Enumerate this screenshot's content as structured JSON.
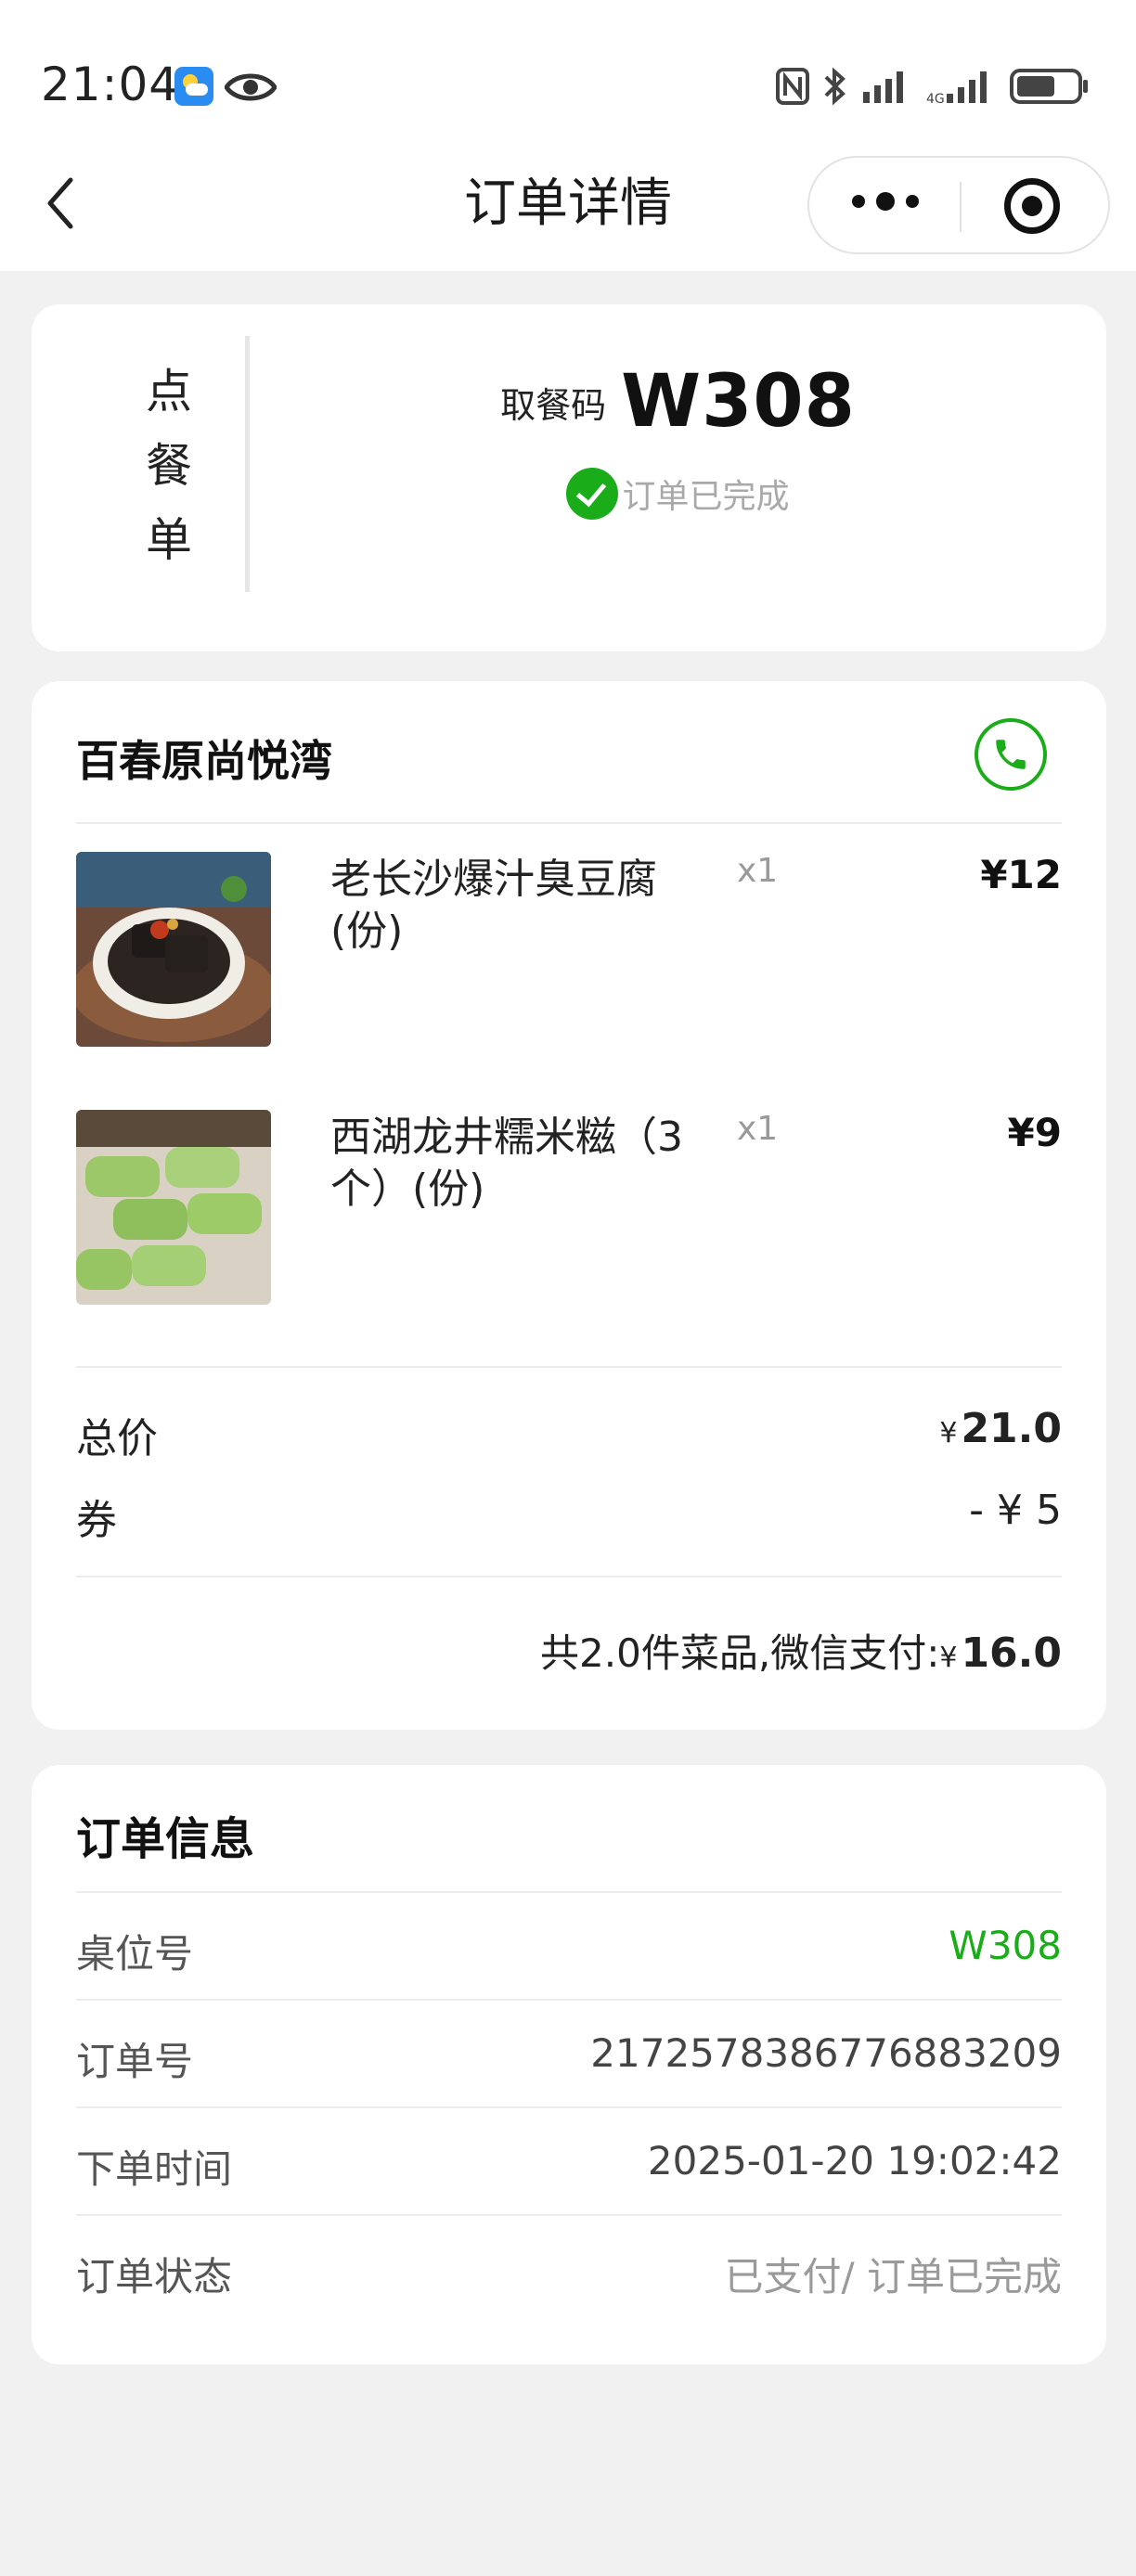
{
  "status_bar": {
    "time": "21:04"
  },
  "nav": {
    "title": "订单详情"
  },
  "pickup": {
    "order_type_chars": [
      "点",
      "餐",
      "单"
    ],
    "label": "取餐码",
    "code": "W308",
    "status": "订单已完成"
  },
  "shop": {
    "name": "百春原尚悦湾",
    "items": [
      {
        "name": "老长沙爆汁臭豆腐(份)",
        "qty": "x1",
        "price": "¥12"
      },
      {
        "name": "西湖龙井糯米糍（3个）(份)",
        "qty": "x1",
        "price": "¥9"
      }
    ],
    "total_label": "总价",
    "total_yen": "¥",
    "total_value": "21.0",
    "coupon_label": "券",
    "coupon_value": "- ¥ 5",
    "pay_prefix": "共2.0件菜品,微信支付:",
    "pay_yen": "¥",
    "pay_value": "16.0"
  },
  "order_info": {
    "title": "订单信息",
    "rows": [
      {
        "key": "桌位号",
        "value": "W308"
      },
      {
        "key": "订单号",
        "value": "2172578386776883209"
      },
      {
        "key": "下单时间",
        "value": "2025-01-20 19:02:42"
      },
      {
        "key": "订单状态",
        "value": "已支付/ 订单已完成"
      }
    ]
  },
  "colors": {
    "accent_green": "#1aad19",
    "page_bg": "#f1f1f1"
  }
}
